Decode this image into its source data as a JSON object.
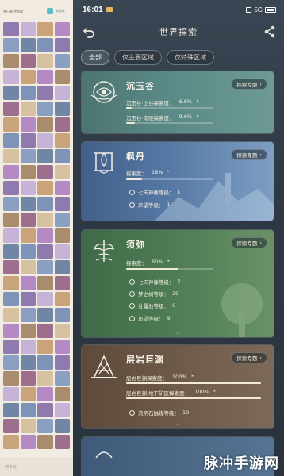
{
  "left_panel": {
    "header_title": "旅行者 完成度",
    "header_icon_label": "米游社",
    "bottom_text": "到今日"
  },
  "status_bar": {
    "time": "16:01",
    "right_text": "5G"
  },
  "page": {
    "title": "世界探索"
  },
  "filters": [
    {
      "label": "全部",
      "active": true
    },
    {
      "label": "仅主要区域",
      "active": false
    },
    {
      "label": "仅特殊区域",
      "active": false
    }
  ],
  "badge_label": "探索专题",
  "regions": [
    {
      "name": "沉玉谷",
      "stats": [
        {
          "label": "沉玉谷·上谷探索度：",
          "value": "6.8%",
          "progress": 0.068
        },
        {
          "label": "沉玉谷·南陵探索度：",
          "value": "9.6%",
          "progress": 0.096
        }
      ],
      "subs": []
    },
    {
      "name": "枫丹",
      "stats": [
        {
          "label": "探索度：",
          "value": "18%",
          "progress": 0.18
        }
      ],
      "subs": [
        {
          "icon": "statue-icon",
          "label": "七天神像等级：",
          "value": "1"
        },
        {
          "icon": "reputation-icon",
          "label": "声望等级：",
          "value": "1"
        }
      ]
    },
    {
      "name": "须弥",
      "stats": [
        {
          "label": "探索度：",
          "value": "60%",
          "progress": 0.6
        }
      ],
      "subs": [
        {
          "icon": "statue-icon",
          "label": "七天神像等级：",
          "value": "7"
        },
        {
          "icon": "tree-icon",
          "label": "梦之树等级：",
          "value": "29"
        },
        {
          "icon": "dew-icon",
          "label": "甘露池等级：",
          "value": "6"
        },
        {
          "icon": "reputation-icon",
          "label": "声望等级：",
          "value": "9"
        }
      ]
    },
    {
      "name": "层岩巨渊",
      "stats": [
        {
          "label": "层岩巨渊探索度：",
          "value": "100%",
          "progress": 1.0
        },
        {
          "label": "层岩巨渊·地下矿区探索度：",
          "value": "100%",
          "progress": 1.0
        }
      ],
      "subs": [
        {
          "icon": "lumenstone-icon",
          "label": "流明石触媒等级：",
          "value": "10"
        }
      ]
    }
  ],
  "watermark": "脉冲手游网",
  "colors": {
    "phone_bg": "#2e3945",
    "chenyu": "#5a8a86",
    "fengdan": "#5578a4",
    "xumi": "#4f7d55",
    "cengyan": "#6e5a48"
  }
}
